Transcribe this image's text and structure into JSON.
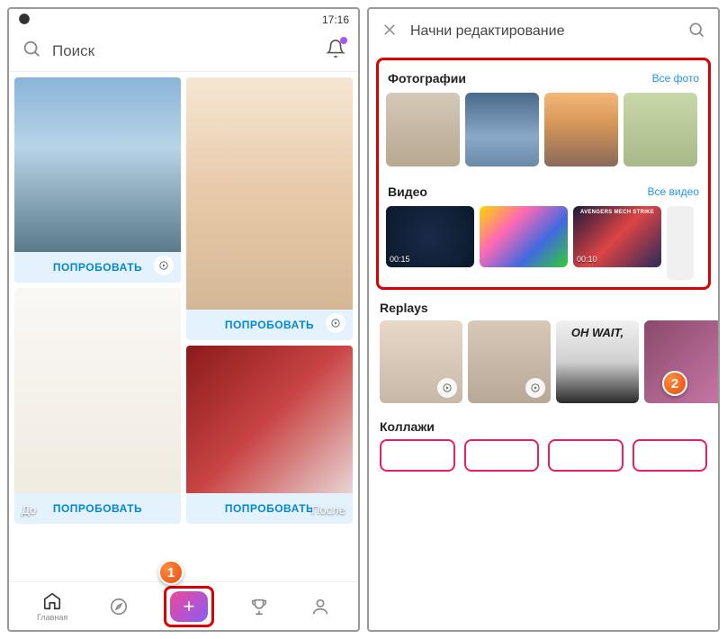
{
  "status": {
    "time": "17:16"
  },
  "search": {
    "placeholder": "Поиск"
  },
  "cards": {
    "try_label": "ПОПРОБОВАТЬ",
    "before_label": "До",
    "after_label": "После"
  },
  "nav": {
    "home": "Главная"
  },
  "callouts": {
    "one": "1",
    "two": "2"
  },
  "screen2": {
    "title": "Начни редактирование",
    "photos": {
      "title": "Фотографии",
      "link": "Все фото"
    },
    "videos": {
      "title": "Видео",
      "link": "Все видео",
      "items": [
        {
          "time": "00:15",
          "label": ""
        },
        {
          "time": "",
          "label": ""
        },
        {
          "time": "00:10",
          "label": "AVENGERS MECH STRIKE"
        }
      ]
    },
    "replays": {
      "title": "Replays",
      "ohwait": "OH WAIT,"
    },
    "collages": {
      "title": "Коллажи"
    }
  }
}
